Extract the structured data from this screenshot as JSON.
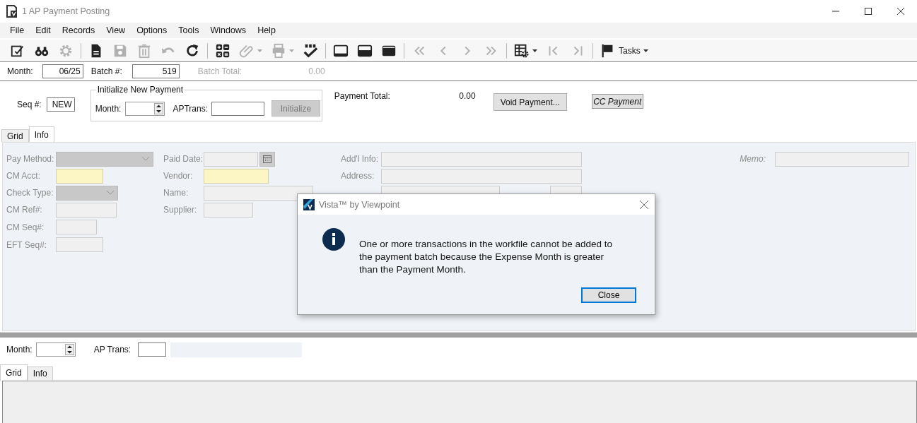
{
  "window": {
    "title": "1 AP Payment Posting"
  },
  "menu": [
    "File",
    "Edit",
    "Records",
    "View",
    "Options",
    "Tools",
    "Windows",
    "Help"
  ],
  "toolbar": [
    {
      "kind": "edit",
      "disabled": false
    },
    {
      "kind": "find",
      "disabled": false
    },
    {
      "kind": "settings",
      "disabled": true
    },
    {
      "kind": "separator"
    },
    {
      "kind": "new",
      "disabled": false
    },
    {
      "kind": "save",
      "disabled": true
    },
    {
      "kind": "delete",
      "disabled": true
    },
    {
      "kind": "undo",
      "disabled": true
    },
    {
      "kind": "refresh",
      "disabled": false
    },
    {
      "kind": "separator"
    },
    {
      "kind": "calculator",
      "disabled": false
    },
    {
      "kind": "attach",
      "disabled": true,
      "dropdown": true
    },
    {
      "kind": "print",
      "disabled": true,
      "dropdown": true
    },
    {
      "kind": "spellcheck",
      "disabled": false
    },
    {
      "kind": "separator"
    },
    {
      "kind": "layout-bottom",
      "disabled": false
    },
    {
      "kind": "layout-split",
      "disabled": false
    },
    {
      "kind": "layout-top",
      "disabled": false
    },
    {
      "kind": "separator"
    },
    {
      "kind": "first",
      "disabled": true
    },
    {
      "kind": "prev",
      "disabled": true
    },
    {
      "kind": "next",
      "disabled": true
    },
    {
      "kind": "last",
      "disabled": true
    },
    {
      "kind": "separator"
    },
    {
      "kind": "grid-settings",
      "disabled": false,
      "dropdown": true
    },
    {
      "kind": "record-first",
      "disabled": true
    },
    {
      "kind": "record-last",
      "disabled": true
    },
    {
      "kind": "separator"
    },
    {
      "kind": "tasks",
      "disabled": false,
      "dropdown": true,
      "label": "Tasks"
    }
  ],
  "header": {
    "month_label": "Month:",
    "month": "06/25",
    "batch_label": "Batch #:",
    "batch": "519",
    "batch_total_label": "Batch Total:",
    "batch_total": "0.00"
  },
  "payment": {
    "seq_label": "Seq #:",
    "seq": "NEW",
    "init_group": {
      "title": "Initialize New Payment",
      "month_label": "Month:",
      "aptrans_label": "APTrans:",
      "button": {
        "label": "Initialize",
        "disabled": true
      }
    },
    "total_label": "Payment Total:",
    "total": "0.00",
    "buttons": [
      {
        "label": "Void Payment...",
        "kind": "normal"
      },
      {
        "label": "CC Payment",
        "kind": "italic"
      }
    ]
  },
  "tabs": [
    {
      "label": "Grid",
      "selected": false
    },
    {
      "label": "Info",
      "selected": true
    }
  ],
  "info": {
    "columns": [
      [
        {
          "label": "Pay Method:",
          "kind": "dropdown"
        },
        {
          "label": "CM Acct:",
          "kind": "text",
          "required": true
        },
        {
          "label": "Check Type:",
          "kind": "dropdown"
        },
        {
          "label": "CM Ref#:",
          "kind": "text",
          "required": false
        },
        {
          "label": "CM Seq#:",
          "kind": "text",
          "required": false
        },
        {
          "label": "EFT Seq#:",
          "kind": "text",
          "required": false
        }
      ],
      [
        {
          "label": "Paid Date:",
          "kind": "date",
          "required": false
        },
        {
          "label": "Vendor:",
          "kind": "text",
          "required": true
        },
        {
          "label": "Name:",
          "kind": "text",
          "required": false
        },
        {
          "label": "Supplier:",
          "kind": "text",
          "required": false
        }
      ],
      [
        {
          "label": "Add'l Info:",
          "kind": "text",
          "required": false
        },
        {
          "label": "Address:",
          "kind": "text",
          "required": false
        },
        {
          "kind": "city-state",
          "required": false
        }
      ]
    ],
    "memo": {
      "label": "Memo:"
    }
  },
  "dialog": {
    "title": "Vista™ by Viewpoint",
    "message": "One or more transactions in the workfile cannot be added to the payment batch because the Expense Month is greater than the Payment Month.",
    "button": "Close"
  },
  "detail": {
    "month_label": "Month:",
    "ap_trans_label": "AP Trans:",
    "tabs": [
      {
        "label": "Grid",
        "selected": true
      },
      {
        "label": "Info",
        "selected": false
      }
    ]
  }
}
